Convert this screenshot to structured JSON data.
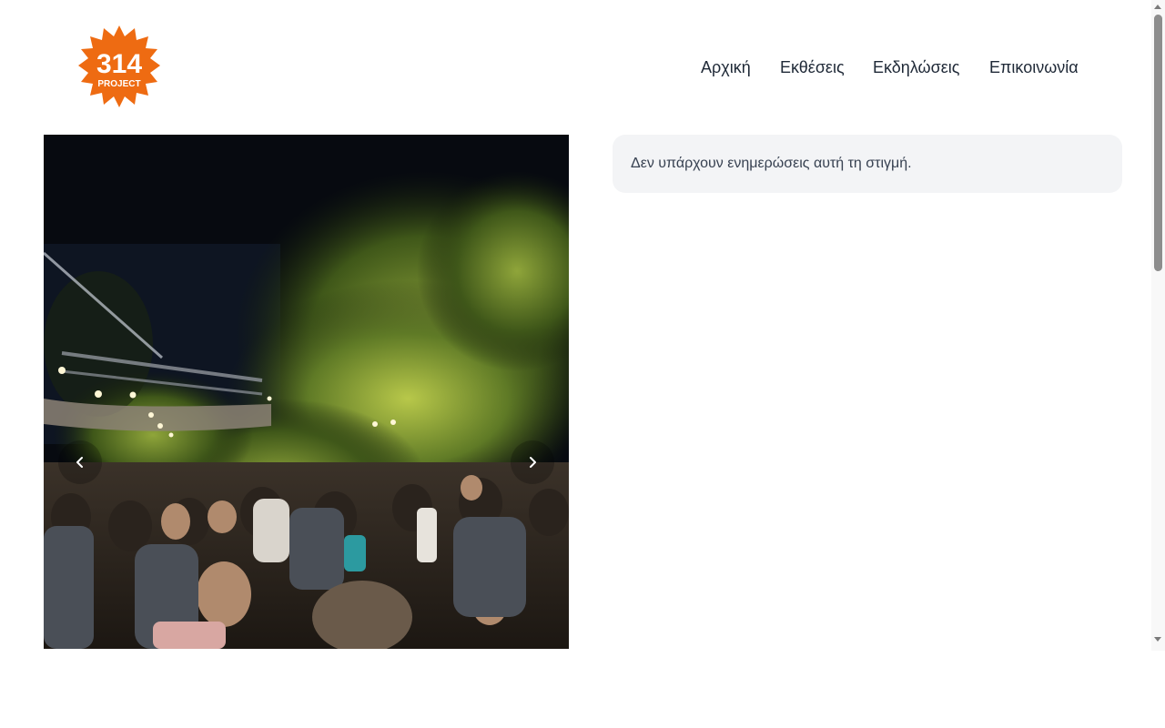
{
  "brand": {
    "logo_number": "314",
    "logo_subtitle": "PROJECT",
    "logo_color": "#ee6b12"
  },
  "nav": {
    "items": [
      {
        "label": "Αρχική"
      },
      {
        "label": "Εκθέσεις"
      },
      {
        "label": "Εκδηλώσεις"
      },
      {
        "label": "Επικοινωνία"
      }
    ]
  },
  "carousel": {
    "prev_icon": "chevron-left-icon",
    "next_icon": "chevron-right-icon"
  },
  "updates": {
    "message": "Δεν υπάρχουν ενημερώσεις αυτή τη στιγμή."
  }
}
